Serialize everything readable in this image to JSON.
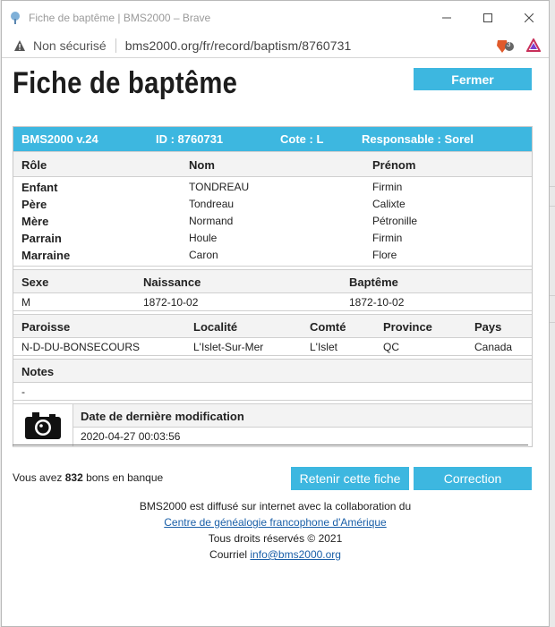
{
  "browser": {
    "window_title": "Fiche de baptême | BMS2000 – Brave",
    "insecure_label": "Non sécurisé",
    "url": "bms2000.org/fr/record/baptism/8760731",
    "shield_badge": "3"
  },
  "page": {
    "title": "Fiche de baptême",
    "close_button": "Fermer"
  },
  "record": {
    "header": {
      "version": "BMS2000 v.24",
      "id": "ID : 8760731",
      "cote": "Cote : L",
      "responsable": "Responsable : Sorel"
    },
    "people_headers": {
      "role": "Rôle",
      "nom": "Nom",
      "prenom": "Prénom"
    },
    "people": [
      {
        "role": "Enfant",
        "nom": "TONDREAU",
        "prenom": "Firmin"
      },
      {
        "role": "Père",
        "nom": "Tondreau",
        "prenom": "Calixte"
      },
      {
        "role": "Mère",
        "nom": "Normand",
        "prenom": "Pétronille"
      },
      {
        "role": "Parrain",
        "nom": "Houle",
        "prenom": "Firmin"
      },
      {
        "role": "Marraine",
        "nom": "Caron",
        "prenom": "Flore"
      }
    ],
    "vitals_headers": {
      "sexe": "Sexe",
      "naissance": "Naissance",
      "bapteme": "Baptême"
    },
    "vitals": {
      "sexe": "M",
      "naissance": "1872-10-02",
      "bapteme": "1872-10-02"
    },
    "place_headers": {
      "paroisse": "Paroisse",
      "localite": "Localité",
      "comte": "Comté",
      "province": "Province",
      "pays": "Pays"
    },
    "place": {
      "paroisse": "N-D-DU-BONSECOURS",
      "localite": "L'Islet-Sur-Mer",
      "comte": "L'Islet",
      "province": "QC",
      "pays": "Canada"
    },
    "notes_header": "Notes",
    "notes": "-",
    "modified_header": "Date de dernière modification",
    "modified": "2020-04-27 00:03:56",
    "camera_icon": "camera-icon"
  },
  "bank": {
    "prefix": "Vous avez ",
    "count": "832",
    "suffix": " bons en banque"
  },
  "actions": {
    "keep": "Retenir cette fiche",
    "correction": "Correction"
  },
  "footer": {
    "line1": "BMS2000 est diffusé sur internet avec la collaboration du",
    "link1": "Centre de généalogie francophone d'Amérique",
    "line3": "Tous droits réservés © 2021",
    "email_prefix": "Courriel ",
    "email": "info@bms2000.org"
  },
  "colors": {
    "accent": "#3db7e0",
    "link": "#1a5fa8"
  }
}
